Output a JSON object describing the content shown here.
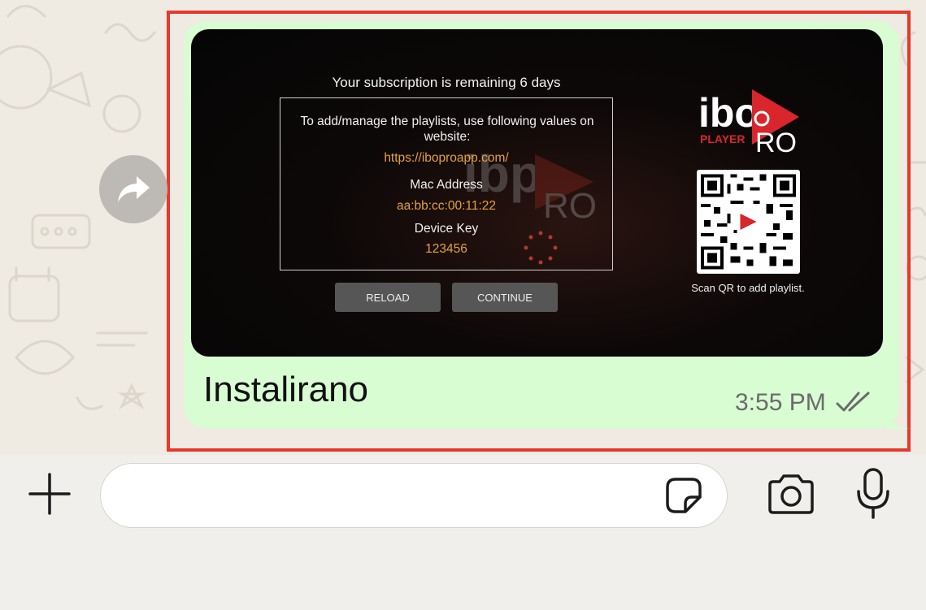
{
  "message": {
    "subscription_text": "Your subscription is remaining 6 days",
    "intro_text": "To add/manage the playlists, use following values on website:",
    "url": "https://iboproapp.com/",
    "mac_label": "Mac Address",
    "mac_value": "aa:bb:cc:00:11:22",
    "device_key_label": "Device Key",
    "device_key_value": "123456",
    "reload_label": "RELOAD",
    "continue_label": "CONTINUE",
    "logo_text_main": "ibo",
    "logo_text_sub": "PLAYER",
    "logo_text_pro": "RO",
    "qr_caption": "Scan QR to add playlist.",
    "caption": "Instalirano",
    "time": "3:55 PM",
    "status": "read",
    "accent_color": "#e4a23a",
    "bubble_color": "#d9fdd3"
  },
  "actions": {
    "forward_icon": "forward-arrow-icon"
  },
  "composer": {
    "plus_icon": "plus-icon",
    "input_value": "",
    "sticker_icon": "sticker-icon",
    "camera_icon": "camera-icon",
    "mic_icon": "microphone-icon"
  },
  "highlight_color": "#e8372b"
}
